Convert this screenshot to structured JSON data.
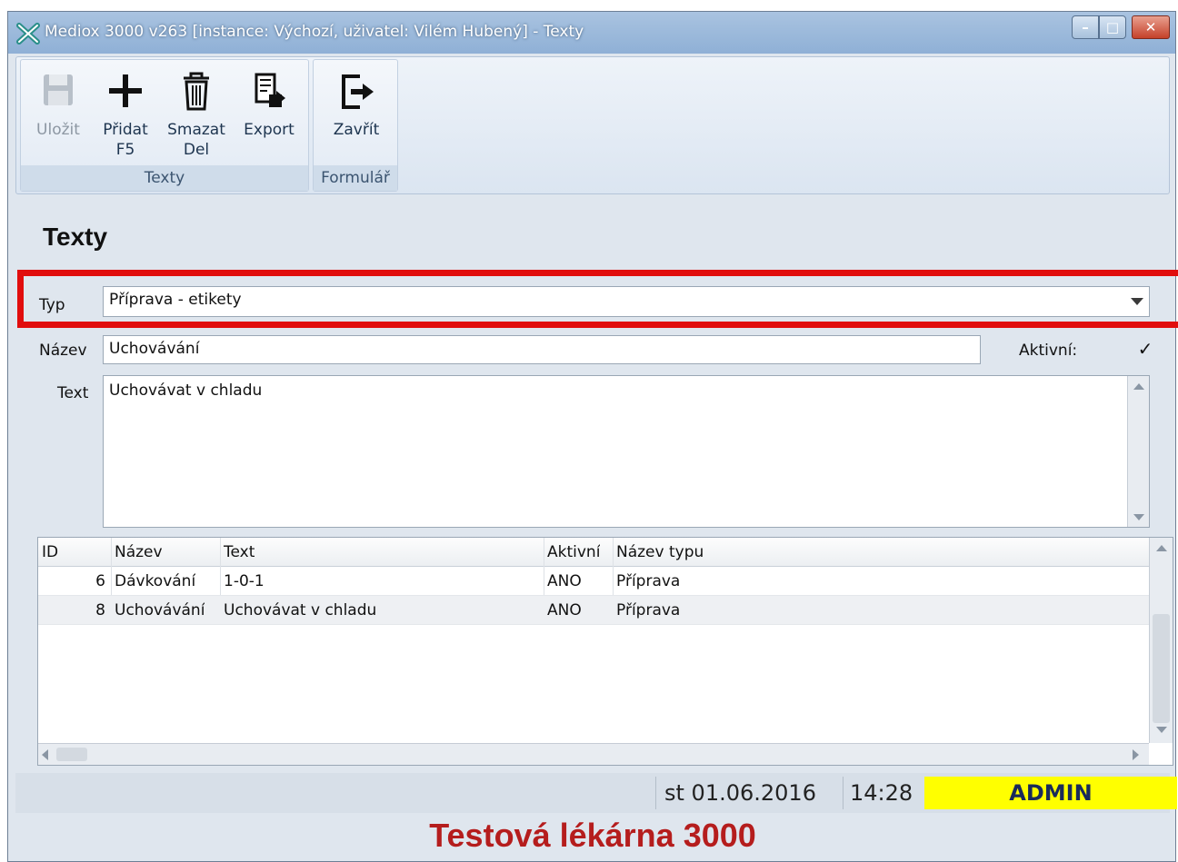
{
  "window": {
    "title": "Mediox 3000 v263 [instance: Výchozí, uživatel: Vilém Hubený] - Texty"
  },
  "ribbon": {
    "groups": [
      {
        "caption": "Texty",
        "buttons": [
          {
            "label": "Uložit",
            "icon": "save-icon",
            "enabled": false
          },
          {
            "label": "Přidat\nF5",
            "icon": "plus-icon",
            "enabled": true
          },
          {
            "label": "Smazat\nDel",
            "icon": "trash-icon",
            "enabled": true
          },
          {
            "label": "Export",
            "icon": "export-icon",
            "enabled": true
          }
        ]
      },
      {
        "caption": "Formulář",
        "buttons": [
          {
            "label": "Zavřít",
            "icon": "exit-icon",
            "enabled": true
          }
        ]
      }
    ]
  },
  "form": {
    "heading": "Texty",
    "typ_label": "Typ",
    "typ_value": "Příprava - etikety",
    "nazev_label": "Název",
    "nazev_value": "Uchovávání",
    "aktivni_label": "Aktivní:",
    "aktivni_checked": true,
    "aktivni_mark": "✓",
    "text_label": "Text",
    "text_value": "Uchovávat v chladu"
  },
  "grid": {
    "columns": [
      "ID",
      "Název",
      "Text",
      "Aktivní",
      "Název typu"
    ],
    "rows": [
      [
        "6",
        "Dávkování",
        "1-0-1",
        "ANO",
        "Příprava"
      ],
      [
        "8",
        "Uchovávání",
        "Uchovávat v chladu",
        "ANO",
        "Příprava"
      ]
    ]
  },
  "status": {
    "date": "st 01.06.2016",
    "time": "14:28",
    "user": "ADMIN",
    "user_bg": "#ffff00"
  },
  "footer": {
    "pharmacy": "Testová lékárna 3000",
    "color": "#b51d1d"
  },
  "highlight_color": "#e10d0d"
}
